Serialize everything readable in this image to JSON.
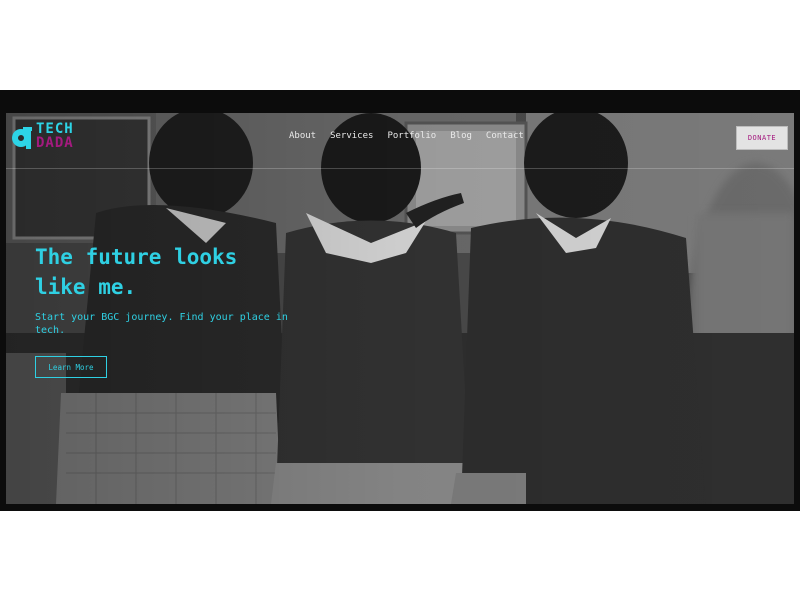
{
  "brand": {
    "logo_line1": "TECH",
    "logo_line2": "DADA",
    "primary_color": "#2dd4e6",
    "secondary_color": "#a41a7f"
  },
  "nav": {
    "items": [
      {
        "label": "About"
      },
      {
        "label": "Services"
      },
      {
        "label": "Portfolio"
      },
      {
        "label": "Blog"
      },
      {
        "label": "Contact"
      }
    ]
  },
  "donate": {
    "label": "DONATE"
  },
  "hero": {
    "headline": "The future looks like me.",
    "subtext": "Start your BGC journey. Find your place in tech.",
    "cta_label": "Learn More",
    "image_description_icon": "hero-photo"
  }
}
